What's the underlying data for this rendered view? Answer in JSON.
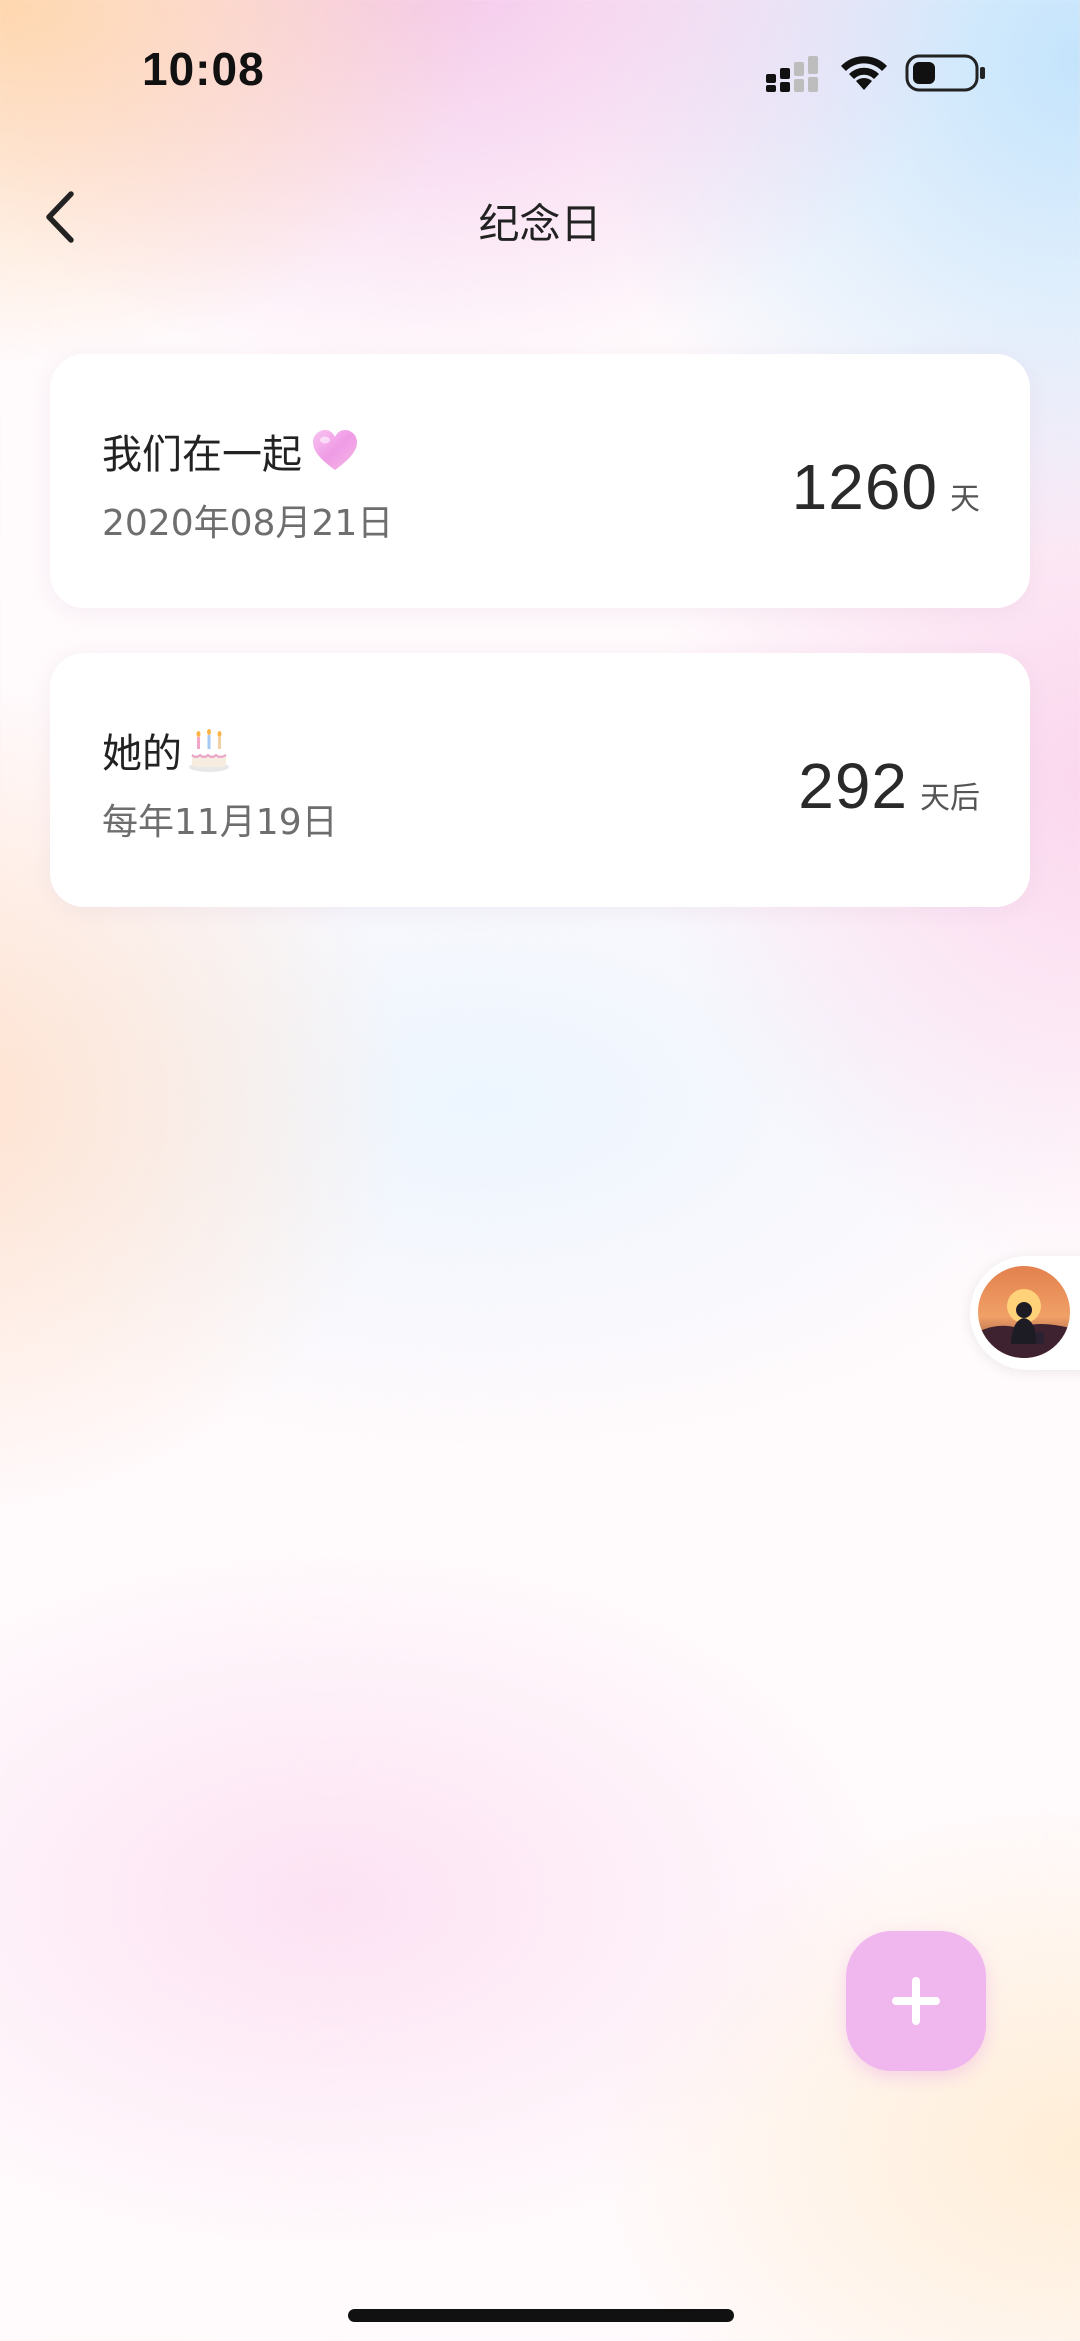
{
  "status_bar": {
    "time": "10:08",
    "signal_icon": "cellular-signal-icon",
    "wifi_icon": "wifi-icon",
    "battery_icon": "battery-low-icon"
  },
  "header": {
    "title": "纪念日",
    "back_icon": "chevron-left-icon"
  },
  "anniversaries": [
    {
      "title": "我们在一起",
      "emoji_icon": "pink-heart-icon",
      "date_text": "2020年08月21日",
      "count": "1260",
      "unit": "天"
    },
    {
      "title": "她的",
      "emoji_icon": "birthday-cake-icon",
      "date_text": "每年11月19日",
      "count": "292",
      "unit": "天后"
    }
  ],
  "floating": {
    "avatar_icon": "user-avatar-sunset-silhouette"
  },
  "add_button": {
    "icon": "plus-icon"
  },
  "colors": {
    "add_button": "#f0b6ee",
    "card_background": "#ffffff",
    "text_primary": "#222222",
    "text_secondary": "#6e6e6e"
  }
}
